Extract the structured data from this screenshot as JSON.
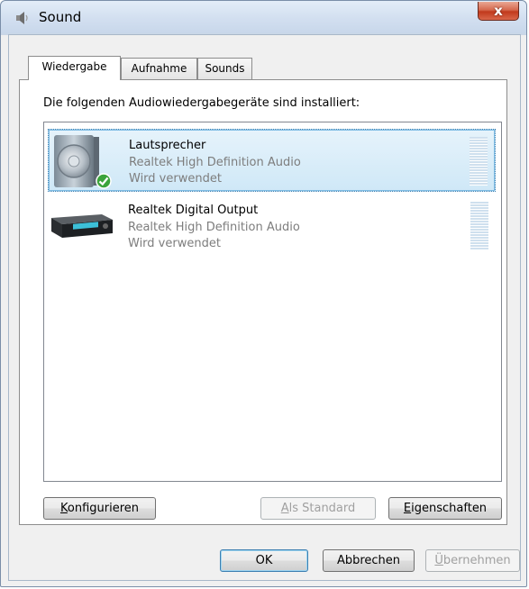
{
  "window": {
    "title": "Sound",
    "close_symbol": "x"
  },
  "tabs": [
    {
      "label": "Wiedergabe",
      "active": true
    },
    {
      "label": "Aufnahme",
      "active": false
    },
    {
      "label": "Sounds",
      "active": false
    }
  ],
  "heading": "Die folgenden Audiowiedergabegeräte sind installiert:",
  "devices": [
    {
      "name": "Lautsprecher",
      "driver": "Realtek High Definition Audio",
      "status": "Wird verwendet",
      "icon": "speaker-icon",
      "default_check": true,
      "selected": true
    },
    {
      "name": "Realtek Digital Output",
      "driver": "Realtek High Definition Audio",
      "status": "Wird verwendet",
      "icon": "digital-output-icon",
      "default_check": false,
      "selected": false
    }
  ],
  "buttons": {
    "configure": {
      "pre": "",
      "key": "K",
      "post": "onfigurieren"
    },
    "set_default": {
      "pre": "",
      "key": "A",
      "post": "ls Standard"
    },
    "properties": {
      "pre": "",
      "key": "E",
      "post": "igenschaften"
    },
    "ok": "OK",
    "cancel": "Abbrechen",
    "apply": {
      "pre": "",
      "key": "Ü",
      "post": "bernehmen"
    }
  }
}
